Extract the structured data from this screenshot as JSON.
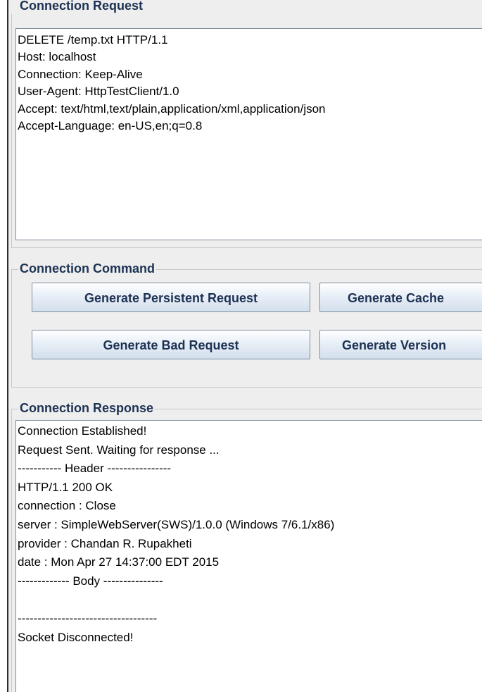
{
  "request_panel": {
    "title": "Connection Request",
    "lines": [
      "DELETE /temp.txt HTTP/1.1",
      "Host: localhost",
      "Connection: Keep-Alive",
      "User-Agent: HttpTestClient/1.0",
      "Accept: text/html,text/plain,application/xml,application/json",
      "Accept-Language: en-US,en;q=0.8"
    ]
  },
  "command_panel": {
    "title": "Connection Command",
    "buttons": {
      "persistent": "Generate Persistent Request",
      "cache": "Generate Cache",
      "bad": "Generate Bad Request",
      "version": "Generate Version"
    }
  },
  "response_panel": {
    "title": "Connection Response",
    "lines": [
      "Connection Established!",
      "Request Sent. Waiting for response ...",
      "----------- Header ----------------",
      "HTTP/1.1 200 OK",
      "connection : Close",
      "server : SimpleWebServer(SWS)/1.0.0 (Windows 7/6.1/x86)",
      "provider : Chandan R. Rupakheti",
      "date : Mon Apr 27 14:37:00 EDT 2015",
      "------------- Body ---------------",
      "",
      "-----------------------------------",
      "Socket Disconnected!"
    ]
  }
}
